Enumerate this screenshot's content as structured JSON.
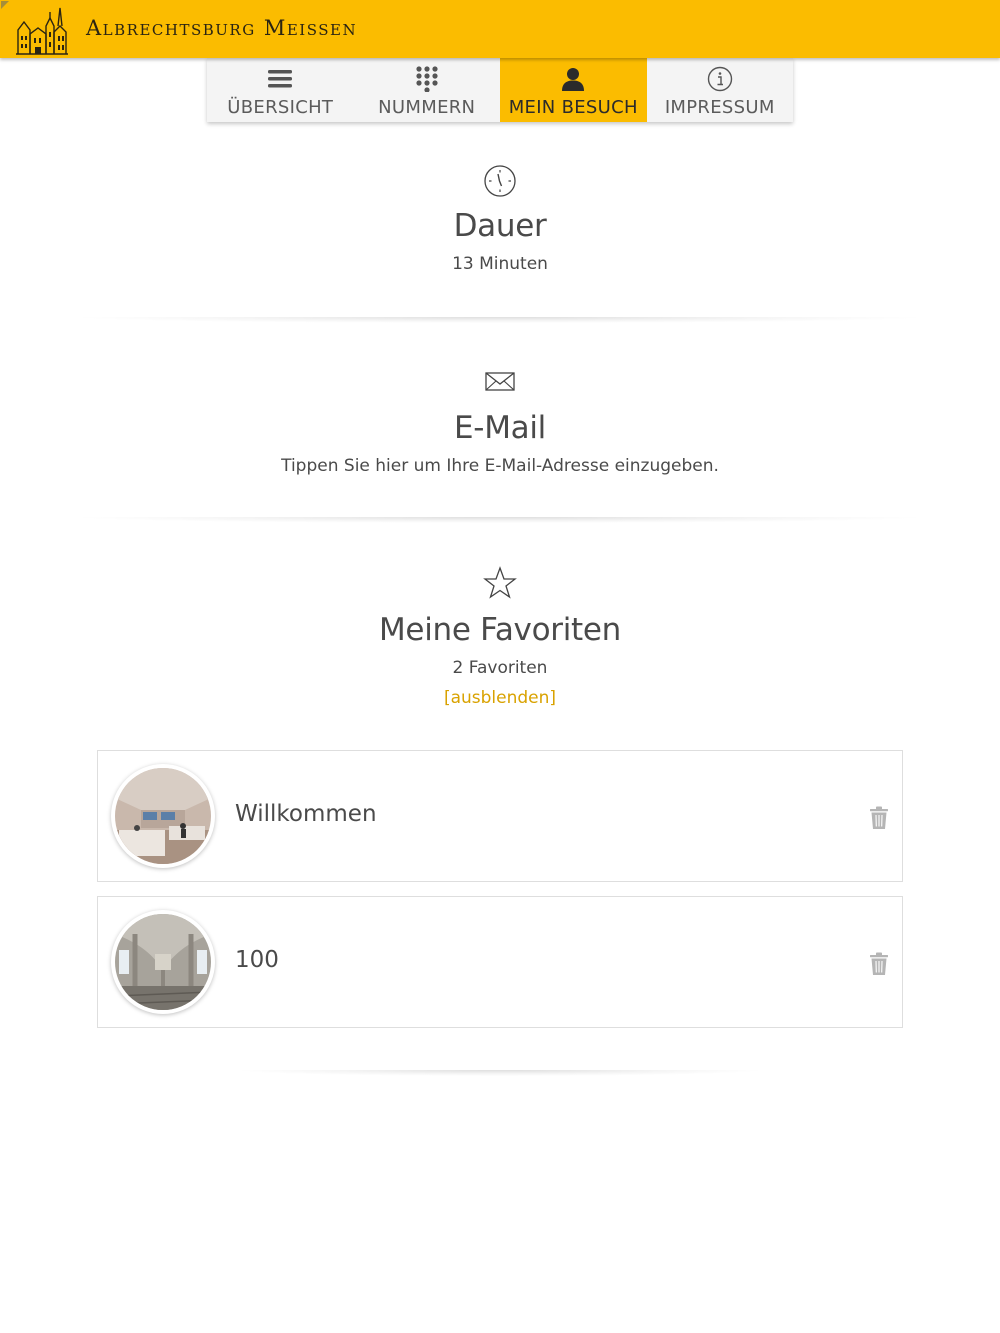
{
  "app": {
    "title": "Albrechtsburg Meissen"
  },
  "colors": {
    "accent": "#fbbc00",
    "link": "#d9a200",
    "text": "#4a4a4a"
  },
  "tabs": [
    {
      "label": "ÜBERSICHT",
      "icon": "menu-icon",
      "active": false
    },
    {
      "label": "NUMMERN",
      "icon": "keypad-icon",
      "active": false
    },
    {
      "label": "MEIN BESUCH",
      "icon": "person-icon",
      "active": true
    },
    {
      "label": "IMPRESSUM",
      "icon": "info-icon",
      "active": false
    }
  ],
  "duration": {
    "icon": "clock-icon",
    "title": "Dauer",
    "value": "13 Minuten"
  },
  "email": {
    "icon": "envelope-icon",
    "title": "E-Mail",
    "hint": "Tippen Sie hier um Ihre E-Mail-Adresse einzugeben."
  },
  "favorites": {
    "icon": "star-icon",
    "title": "Meine Favoriten",
    "count": "2 Favoriten",
    "toggle_label": "[ausblenden]",
    "items": [
      {
        "label": "Willkommen",
        "thumb": "reception-room-photo"
      },
      {
        "label": "100",
        "thumb": "gothic-hall-photo"
      }
    ]
  }
}
